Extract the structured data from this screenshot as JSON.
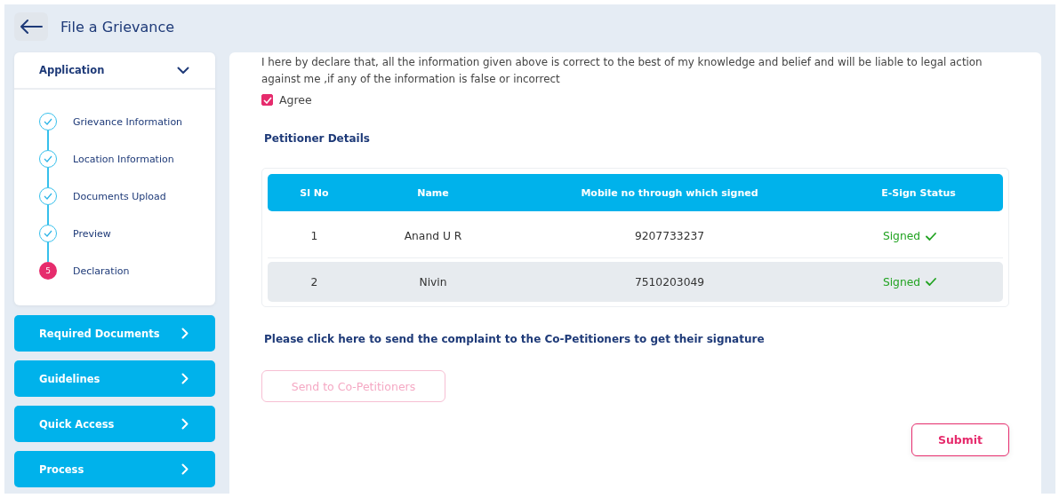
{
  "header": {
    "title": "File a Grievance"
  },
  "sidebar": {
    "section": {
      "title": "Application",
      "expanded": true,
      "steps": [
        {
          "label": "Grievance Information",
          "completed": true
        },
        {
          "label": "Location Information",
          "completed": true
        },
        {
          "label": "Documents Upload",
          "completed": true
        },
        {
          "label": "Preview",
          "completed": true
        },
        {
          "label": "Declaration",
          "completed": false,
          "number": "5"
        }
      ]
    },
    "links": [
      "Required Documents",
      "Guidelines",
      "Quick Access",
      "Process"
    ]
  },
  "declaration": {
    "text": "I here by declare that, all the information given above is correct to the best of my knowledge and belief and will be liable to legal action against me ,if any of the information is false or incorrect",
    "agree": {
      "label": "Agree",
      "checked": true
    }
  },
  "petitioners": {
    "title": "Petitioner Details",
    "columns": [
      "Sl No",
      "Name",
      "Mobile no through which signed",
      "E-Sign Status"
    ],
    "rows": [
      {
        "cells": [
          "1",
          "Anand U R",
          "9207733237"
        ],
        "status": "Signed",
        "signed": true,
        "highlighted": false
      },
      {
        "cells": [
          "2",
          "Nivin",
          "7510203049"
        ],
        "status": "Signed",
        "signed": true,
        "highlighted": true
      }
    ]
  },
  "co_petitioner_note": "Please click here to send the complaint to the Co-Petitioners to get their signature",
  "send_button": {
    "label": "Send to Co-Petitioners",
    "disabled": true
  },
  "submit_button": {
    "label": "Submit"
  }
}
